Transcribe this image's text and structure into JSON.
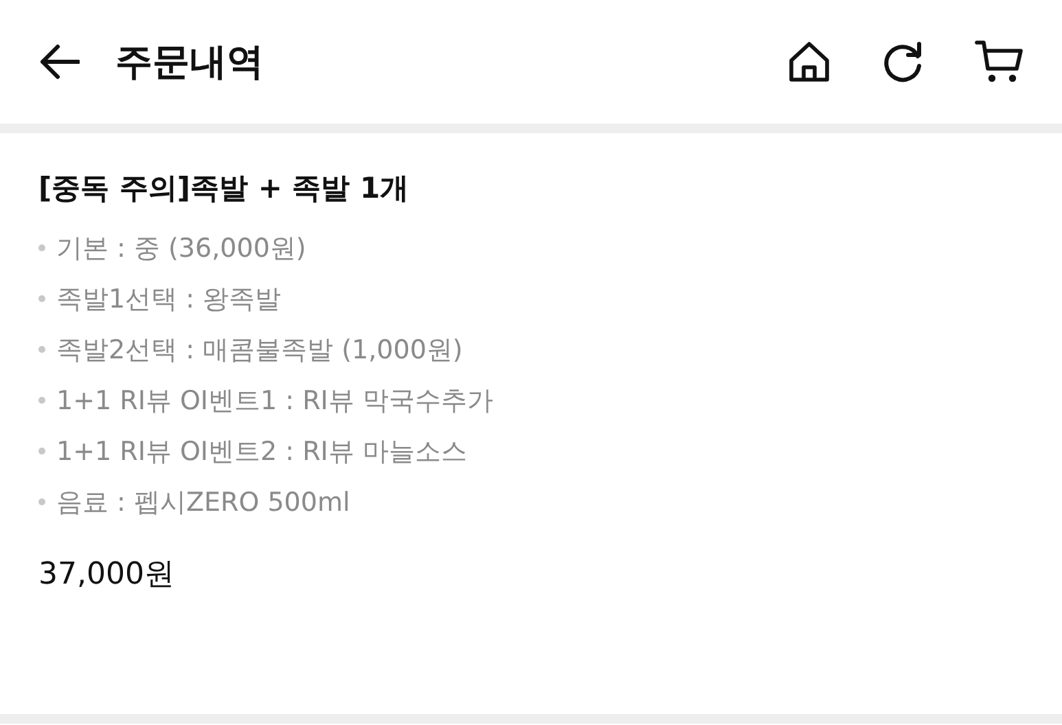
{
  "header": {
    "title": "주문내역"
  },
  "order": {
    "product": "[중독 주의]족발 + 족발 1개",
    "options": [
      "기본 : 중 (36,000원)",
      "족발1선택 : 왕족발",
      "족발2선택 : 매콤불족발 (1,000원)",
      "1+1 RI뷰 OI벤트1 : RI뷰 막국수추가",
      "1+1 RI뷰 OI벤트2 : RI뷰 마늘소스",
      "음료 : 펩시ZERO 500ml"
    ],
    "price": "37,000원"
  }
}
